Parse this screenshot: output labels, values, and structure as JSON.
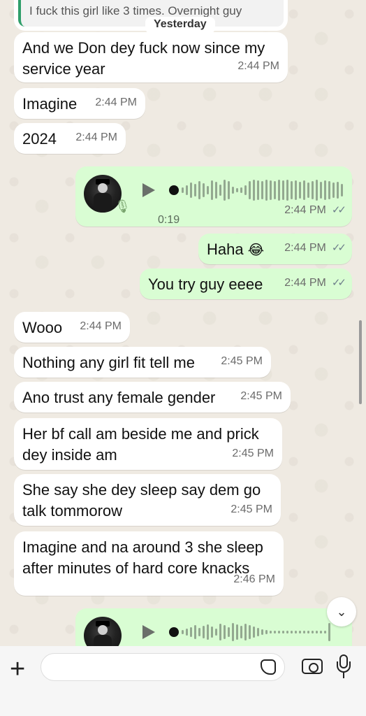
{
  "date_chip": "Yesterday",
  "quoted_message": "I fuck this girl like 3 times. Overnight guy",
  "messages": [
    {
      "text": "And we Don dey fuck now since my\nservice year",
      "time": "2:44 PM"
    },
    {
      "text": "Imagine",
      "time": "2:44 PM"
    },
    {
      "text": "2024",
      "time": "2:44 PM"
    },
    {
      "voice_duration": "0:19",
      "time": "2:44 PM"
    },
    {
      "text": "Haha",
      "emoji": "😂",
      "time": "2:44 PM"
    },
    {
      "text": "You try guy eeee",
      "time": "2:44 PM"
    },
    {
      "text": "Wooo",
      "time": "2:44 PM"
    },
    {
      "text": "Nothing any girl fit tell me",
      "time": "2:45 PM"
    },
    {
      "text": "Ano trust any female gender",
      "time": "2:45 PM"
    },
    {
      "text": "Her bf call am beside me and prick\ndey inside am",
      "time": "2:45 PM"
    },
    {
      "text": "She say she dey sleep say dem go\ntalk tommorow",
      "time": "2:45 PM"
    },
    {
      "text": "Imagine and na around 3 she sleep\nafter minutes of hard core knacks",
      "time": "2:46 PM"
    }
  ],
  "ticks": "✓✓",
  "icons": {
    "scroll_down": "chevron-down-icon",
    "plus": "plus-icon",
    "sticker": "sticker-icon",
    "camera": "camera-icon",
    "mic": "microphone-icon"
  },
  "colors": {
    "outgoing": "#d9fdd3",
    "incoming": "#ffffff",
    "background": "#efeae2"
  }
}
